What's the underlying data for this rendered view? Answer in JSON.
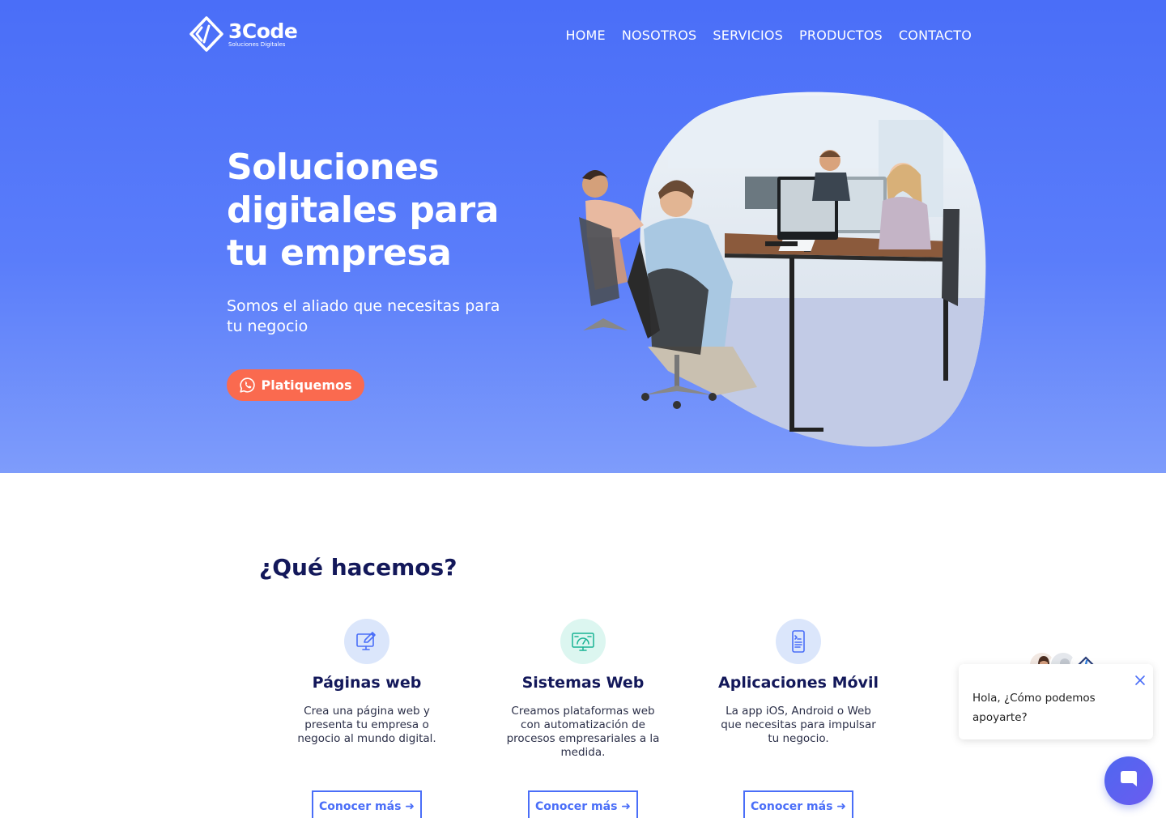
{
  "brand": {
    "name": "3Code",
    "tagline": "Soluciones Digitales"
  },
  "nav": {
    "items": [
      {
        "label": "HOME"
      },
      {
        "label": "NOSOTROS"
      },
      {
        "label": "SERVICIOS"
      },
      {
        "label": "PRODUCTOS"
      },
      {
        "label": "CONTACTO"
      }
    ]
  },
  "hero": {
    "title": "Soluciones digitales para tu empresa",
    "subtitle": "Somos el aliado que necesitas para tu negocio",
    "cta_label": "Platiquemos",
    "cta_icon": "whatsapp-icon",
    "colors": {
      "background": "#4a6ef8",
      "cta": "#fa6a4f"
    }
  },
  "services": {
    "title": "¿Qué hacemos?",
    "items": [
      {
        "icon": "monitor-edit-icon",
        "title": "Páginas web",
        "description": "Crea una página web y presenta tu empresa o negocio al mundo digital.",
        "button": "Conocer más ➜"
      },
      {
        "icon": "dashboard-monitor-icon",
        "title": "Sistemas Web",
        "description": "Creamos plataformas web con automatización de procesos empresariales a la medida.",
        "button": "Conocer más ➜"
      },
      {
        "icon": "smartphone-code-icon",
        "title": "Aplicaciones Móvil",
        "description": "La app iOS, Android o Web que necesitas para impulsar tu negocio.",
        "button": "Conocer más ➜"
      }
    ]
  },
  "chat": {
    "greeting": "Hola, ¿Cómo podemos apoyarte?",
    "launcher_icon": "chat-icon",
    "close_icon": "close-icon"
  }
}
